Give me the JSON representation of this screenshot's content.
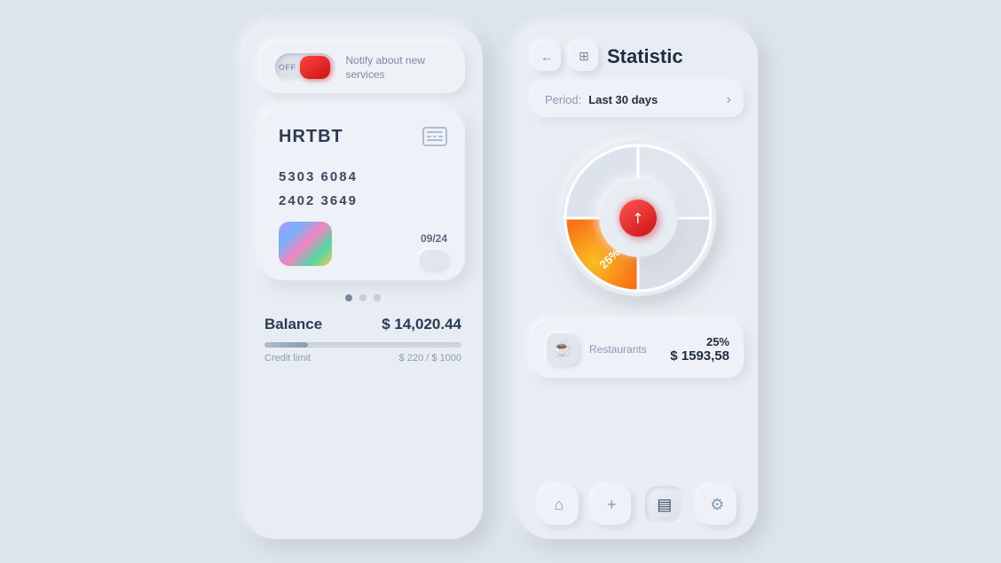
{
  "left_phone": {
    "notify": {
      "toggle_label": "OFF",
      "text_line1": "Notify about",
      "text_line2": "new services"
    },
    "card": {
      "brand": "HRTBT",
      "number_line1": "5303  6084",
      "number_line2": "2402  3649",
      "expiry": "09/24"
    },
    "balance": {
      "label": "Balance",
      "value": "$ 14,020.44",
      "credit_label": "Credit limit",
      "credit_value": "$ 220 / $ 1000",
      "progress_pct": 22
    }
  },
  "right_phone": {
    "header": {
      "back_icon": "←",
      "grid_icon": "⊞",
      "title": "Statistic"
    },
    "period": {
      "label": "Period:",
      "value": "Last 30 days",
      "arrow": "›"
    },
    "chart": {
      "center_arrow": "↗",
      "percentage_label": "25%",
      "segments": [
        {
          "label": "orange",
          "pct": 25,
          "color": "#f97316",
          "start": 0,
          "end": 90
        },
        {
          "label": "light1",
          "pct": 25,
          "color": "#e8edf4",
          "start": 90,
          "end": 180
        },
        {
          "label": "light2",
          "pct": 25,
          "color": "#dce3ec",
          "start": 180,
          "end": 270
        },
        {
          "label": "light3",
          "pct": 25,
          "color": "#e4e9f0",
          "start": 270,
          "end": 360
        }
      ]
    },
    "category": {
      "icon": "☕",
      "label": "Restaurants",
      "percentage": "25%",
      "amount": "$ 1593,58"
    },
    "nav": {
      "home_icon": "⌂",
      "add_icon": "+",
      "cards_icon": "▤",
      "settings_icon": "⚙"
    }
  }
}
